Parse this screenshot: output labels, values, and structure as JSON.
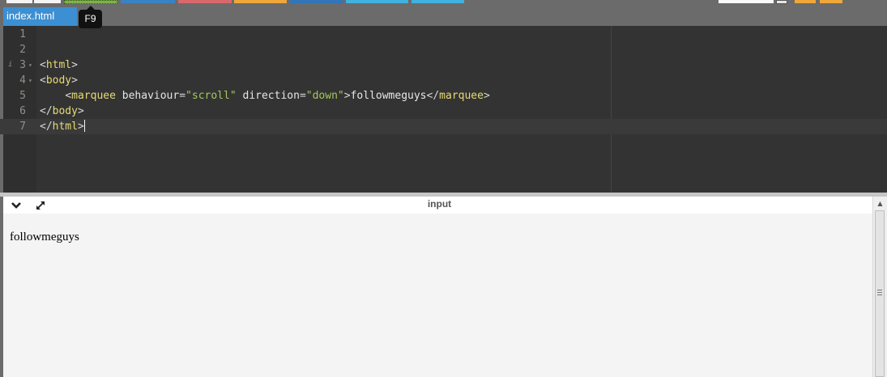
{
  "toolbar": {
    "run_tooltip": "F9",
    "accent_colors": [
      "#7fb24a",
      "#3b82c4",
      "#d9686b",
      "#f0a73a",
      "#3275b8",
      "#40b2dd",
      "#40b2dd"
    ]
  },
  "tabs": [
    {
      "label": "index.html",
      "active": true
    }
  ],
  "editor": {
    "active_line": 7,
    "lines": [
      {
        "number": "1"
      },
      {
        "number": "2"
      },
      {
        "number": "3",
        "info": "i",
        "fold": "▾",
        "parts": [
          {
            "cls": "t-brk",
            "text": "<"
          },
          {
            "cls": "t-tag",
            "text": "html"
          },
          {
            "cls": "t-brk",
            "text": ">"
          }
        ]
      },
      {
        "number": "4",
        "fold": "▾",
        "parts": [
          {
            "cls": "t-brk",
            "text": "<"
          },
          {
            "cls": "t-tag",
            "text": "body"
          },
          {
            "cls": "t-brk",
            "text": ">"
          }
        ]
      },
      {
        "number": "5",
        "parts": [
          {
            "cls": "t-txt",
            "text": "    "
          },
          {
            "cls": "t-brk",
            "text": "<"
          },
          {
            "cls": "t-tag",
            "text": "marquee"
          },
          {
            "cls": "t-txt",
            "text": " "
          },
          {
            "cls": "t-attr",
            "text": "behaviour"
          },
          {
            "cls": "t-op",
            "text": "="
          },
          {
            "cls": "t-str",
            "text": "\"scroll\""
          },
          {
            "cls": "t-txt",
            "text": " "
          },
          {
            "cls": "t-attr",
            "text": "direction"
          },
          {
            "cls": "t-op",
            "text": "="
          },
          {
            "cls": "t-str",
            "text": "\"down\""
          },
          {
            "cls": "t-brk",
            "text": ">"
          },
          {
            "cls": "t-txt",
            "text": "followmeguys"
          },
          {
            "cls": "t-brk",
            "text": "</"
          },
          {
            "cls": "t-tag",
            "text": "marquee"
          },
          {
            "cls": "t-brk",
            "text": ">"
          }
        ]
      },
      {
        "number": "6",
        "parts": [
          {
            "cls": "t-brk",
            "text": "</"
          },
          {
            "cls": "t-tag",
            "text": "body"
          },
          {
            "cls": "t-brk",
            "text": ">"
          }
        ]
      },
      {
        "number": "7",
        "cursor": true,
        "parts": [
          {
            "cls": "t-brk",
            "text": "</"
          },
          {
            "cls": "t-tag",
            "text": "html"
          },
          {
            "cls": "t-brk",
            "text": ">"
          }
        ]
      }
    ]
  },
  "output": {
    "title": "input",
    "collapse_icon": "chevron-down-icon",
    "expand_icon": "expand-arrows-icon",
    "preview_text": "followmeguys"
  }
}
